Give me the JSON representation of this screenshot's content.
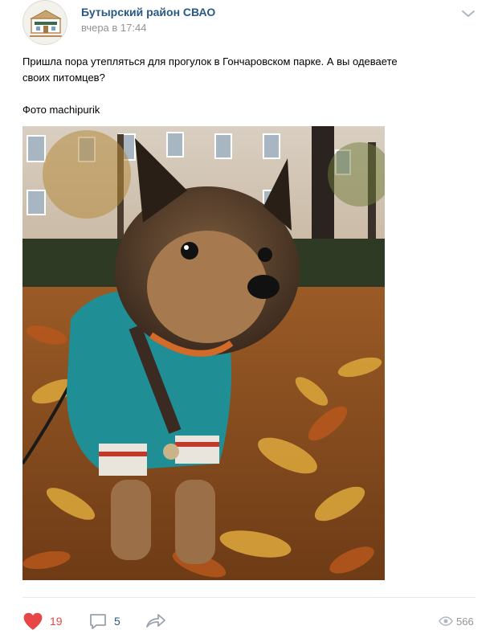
{
  "post": {
    "author": "Бутырский район СВАО",
    "time": "вчера в 17:44",
    "text_line1": "Пришла пора утепляться для прогулок в Гончаровском парке. А вы одеваете",
    "text_line2": "своих питомцев?",
    "caption": "Фото machipurik"
  },
  "actions": {
    "likes": "19",
    "comments": "5",
    "views": "566"
  },
  "icons": {
    "avatar": "community-logo-icon",
    "more": "chevron-down-icon",
    "like": "heart-icon",
    "comment": "comment-icon",
    "share": "share-arrow-icon",
    "views": "eye-icon"
  },
  "colors": {
    "link": "#2a5885",
    "like": "#e64646",
    "muted": "#939393",
    "divider": "#e7e8ec"
  }
}
